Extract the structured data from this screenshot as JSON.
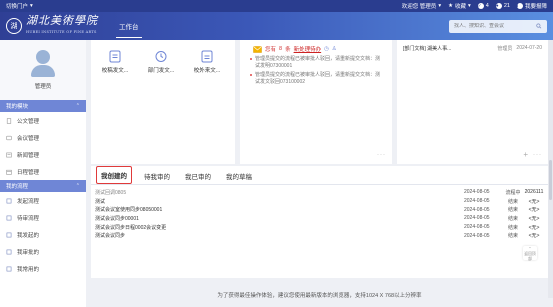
{
  "topbar": {
    "portal": "切换门户",
    "welcome": "欢迎您 管理员",
    "favorites": "收藏",
    "badge_count_1": "4",
    "badge_count_2": "21",
    "my_app": "我要报障"
  },
  "header": {
    "school_name": "湖北美術學院",
    "school_en": "HUBEI INSTITUTE OF FINE ARTS",
    "nav_workbench": "工作台",
    "search_placeholder": "找人、搜知识、查会议"
  },
  "sidebar": {
    "user_name": "管理员",
    "groups": [
      {
        "title": "我的模块",
        "items": [
          "公文管理",
          "会议管理",
          "新闻管理",
          "日程管理"
        ]
      },
      {
        "title": "我的流程",
        "items": [
          "发起流程",
          "待审流程",
          "我发起的",
          "我审批的",
          "我常用的"
        ]
      }
    ]
  },
  "quick_links": [
    "校稿发文...",
    "部门发文...",
    "校外来文..."
  ],
  "todo": {
    "prefix": "您有",
    "count": "8",
    "suffix": "条",
    "link": "新处理待办",
    "items": [
      "管理员提交的流程已被审批人驳回，请重新提交文档：测试发明07300001",
      "管理员提交的流程已被审批人驳回，请重新提交文档：测试发文驳回073100002"
    ]
  },
  "news": {
    "items": [
      {
        "title": "[部门文档] 湖美人事...",
        "group": "管理员",
        "date": "2024-07-20"
      }
    ]
  },
  "flow": {
    "tabs": [
      "我创建的",
      "待我审的",
      "我已审的",
      "我的草稿"
    ],
    "rows": [
      {
        "title": "测试回调0805",
        "date": "2024-08-05",
        "status": "流程中",
        "code": "2026111"
      },
      {
        "title": "测试",
        "date": "2024-08-05",
        "status": "结束",
        "code": "<无>"
      },
      {
        "title": "测试会议室使用同步08050001",
        "date": "2024-08-05",
        "status": "结束",
        "code": "<无>"
      },
      {
        "title": "测试会议同步00001",
        "date": "2024-08-05",
        "status": "结束",
        "code": "<无>"
      },
      {
        "title": "测试会议同步日程0002会议变更",
        "date": "2024-08-05",
        "status": "结束",
        "code": "<无>"
      },
      {
        "title": "测试会议同步",
        "date": "2024-08-05",
        "status": "结束",
        "code": "<无>"
      }
    ]
  },
  "back_to_top": "返回顶部",
  "footer": "为了获得最佳操作体验，建议您使用最新版本的浏览器，支持1024 X 768以上分辨率",
  "colors": {
    "brand_dark": "#2a3d8f",
    "sidebar_group": "#6f86d6",
    "tab_active_border": "#e03a3a",
    "todo_red": "#d23b3b"
  }
}
